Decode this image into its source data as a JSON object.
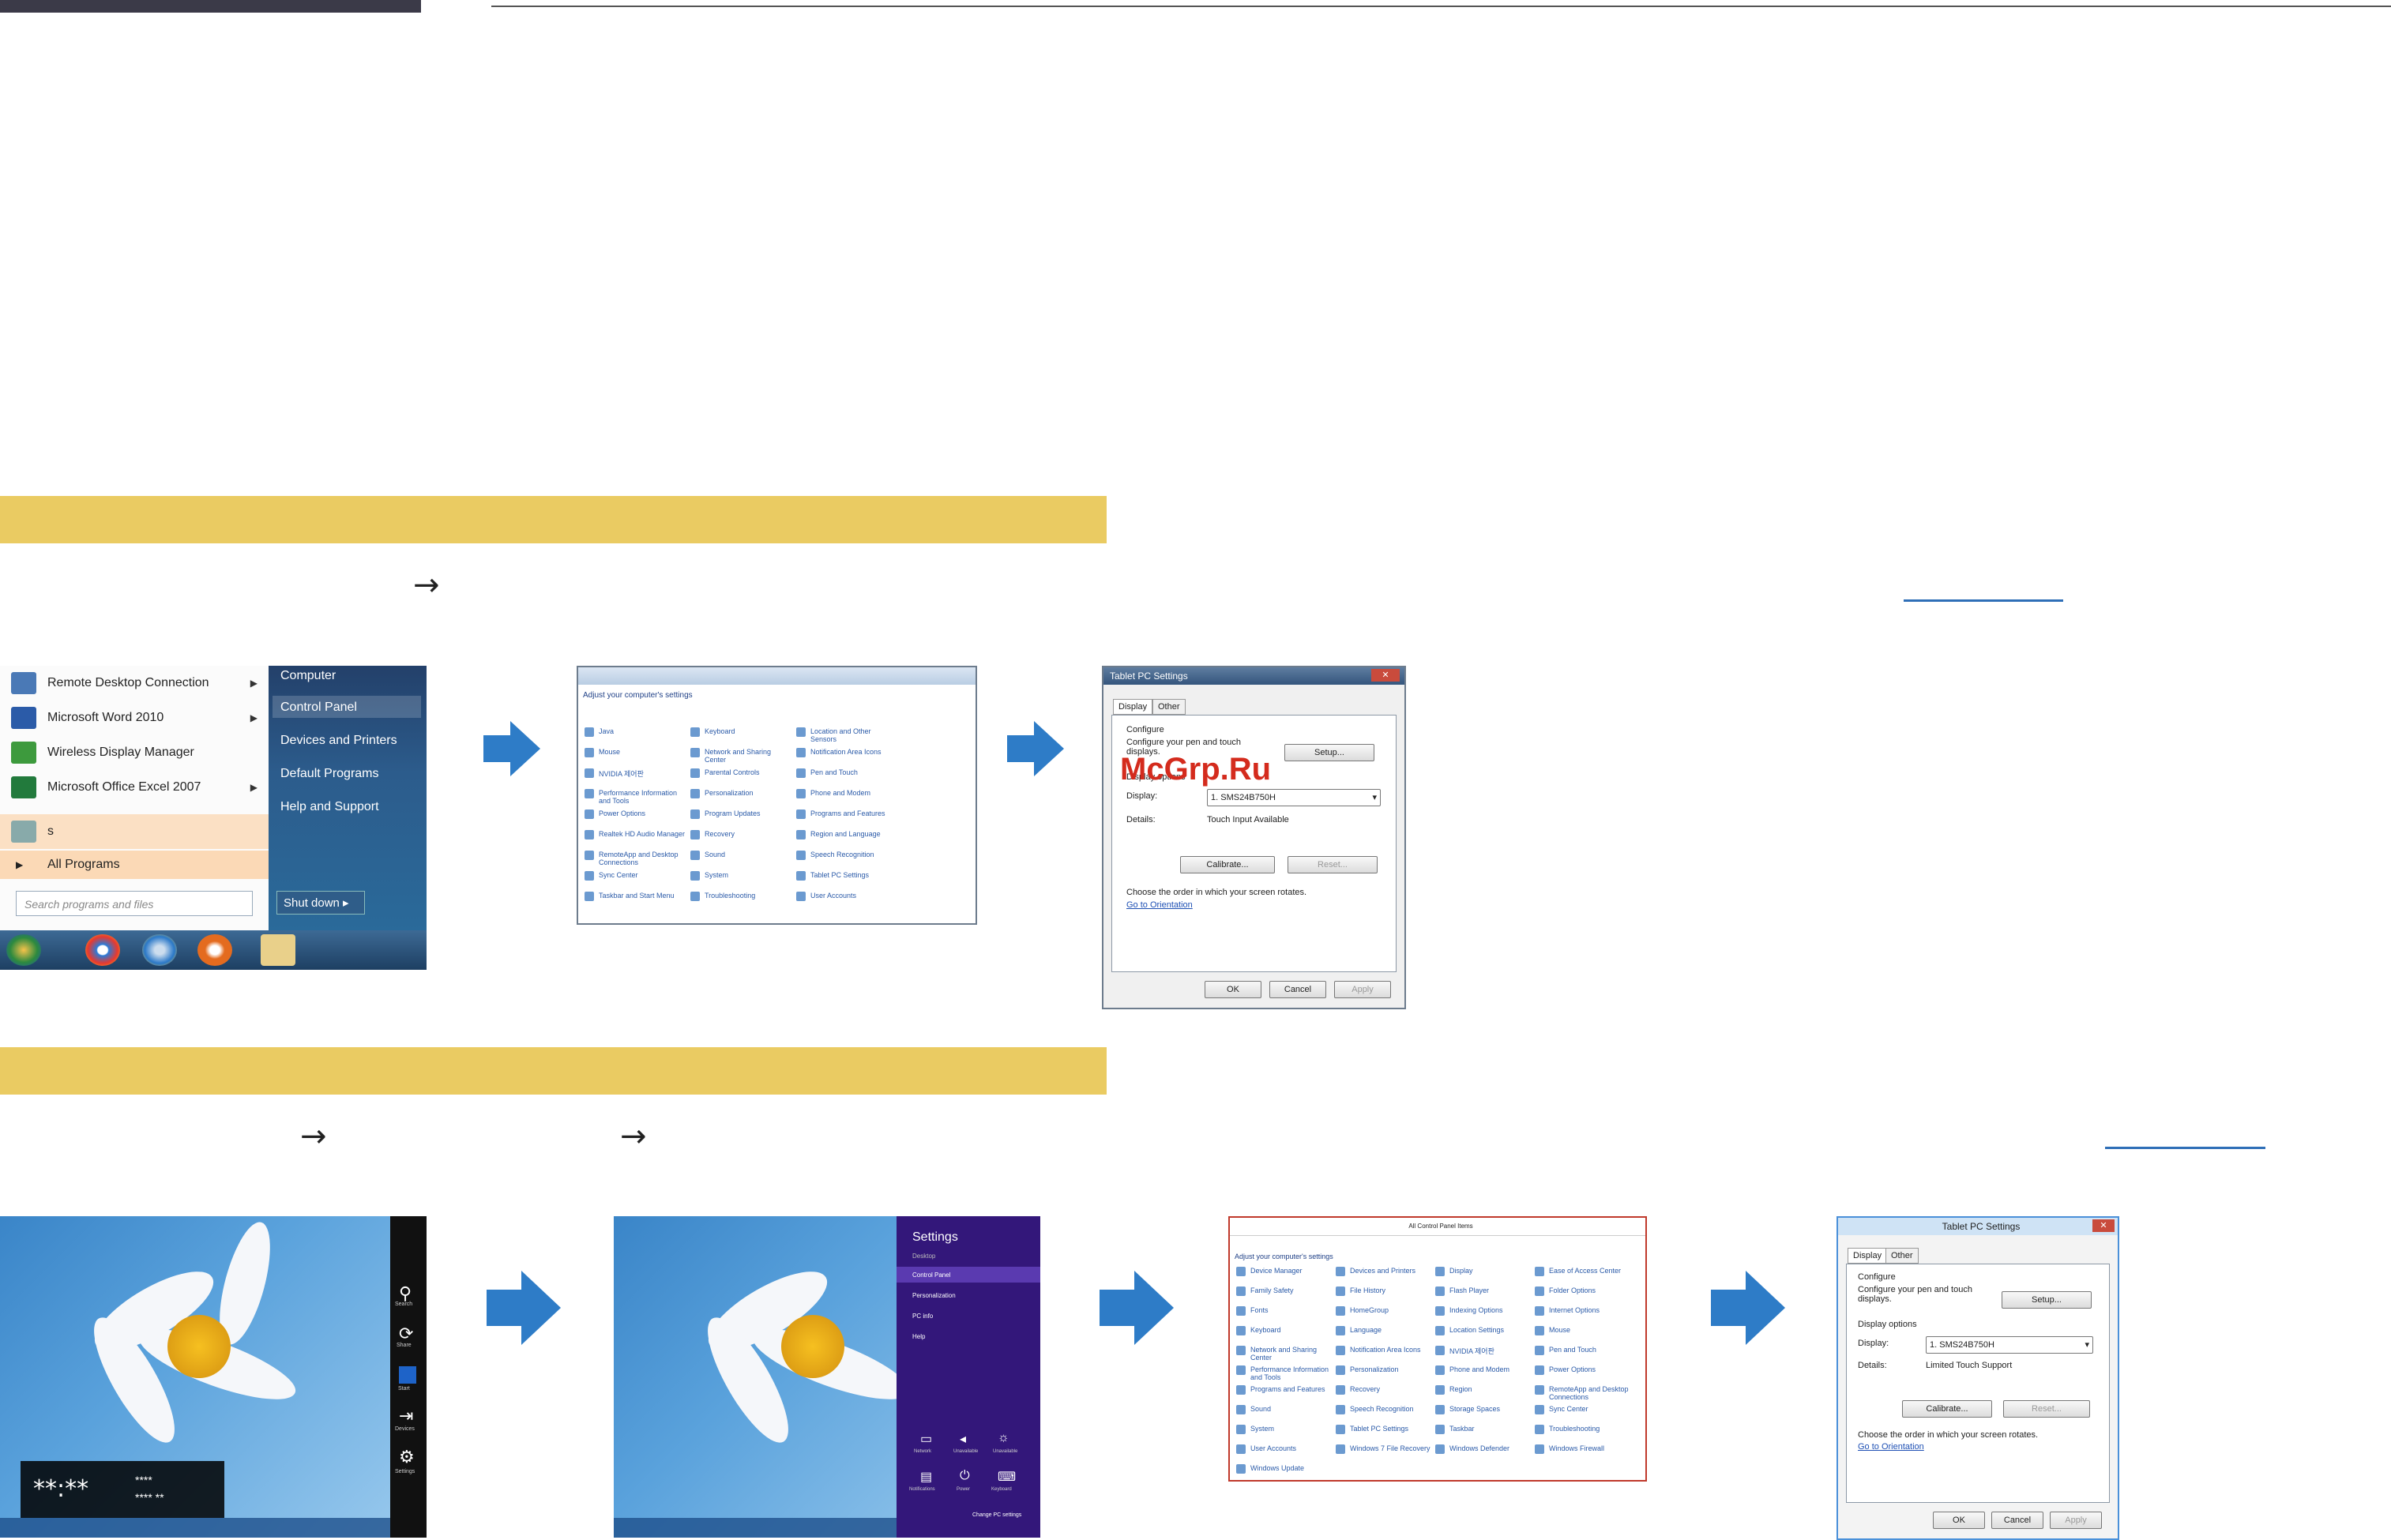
{
  "watermark": "McGrp.Ru",
  "section1": {
    "arrow": "→",
    "start_menu": {
      "programs": [
        {
          "label": "Remote Desktop Connection",
          "has_submenu": true
        },
        {
          "label": "Microsoft Word 2010",
          "has_submenu": true
        },
        {
          "label": "Wireless Display Manager",
          "has_submenu": false
        },
        {
          "label": "Microsoft Office Excel 2007",
          "has_submenu": true
        },
        {
          "label": "s",
          "has_submenu": false
        }
      ],
      "all_programs": "All Programs",
      "search_placeholder": "Search programs and files",
      "right_items": [
        "Computer",
        "Control Panel",
        "Devices and Printers",
        "Default Programs",
        "Help and Support"
      ],
      "shutdown": "Shut down"
    },
    "control_panel": {
      "heading": "Adjust your computer's settings",
      "items": [
        "Java",
        "Keyboard",
        "Location and Other Sensors",
        "Mouse",
        "Network and Sharing Center",
        "Notification Area Icons",
        "NVIDIA 제어판",
        "Parental Controls",
        "Pen and Touch",
        "Performance Information and Tools",
        "Personalization",
        "Phone and Modem",
        "Power Options",
        "Program Updates",
        "Programs and Features",
        "Realtek HD Audio Manager",
        "Recovery",
        "Region and Language",
        "RemoteApp and Desktop Connections",
        "Sound",
        "Speech Recognition",
        "Sync Center",
        "System",
        "Tablet PC Settings",
        "Taskbar and Start Menu",
        "Troubleshooting",
        "User Accounts"
      ]
    },
    "tablet_settings": {
      "title": "Tablet PC Settings",
      "tabs": [
        "Display",
        "Other"
      ],
      "configure": "Configure",
      "configure_desc": "Configure your pen and touch displays.",
      "setup": "Setup...",
      "display_options": "Display options",
      "display_label": "Display:",
      "display_value": "1. SMS24B750H",
      "details_label": "Details:",
      "details_value": "Touch Input Available",
      "calibrate": "Calibrate...",
      "reset": "Reset...",
      "orientation_text": "Choose the order in which your screen rotates.",
      "orientation_link": "Go to Orientation",
      "ok": "OK",
      "cancel": "Cancel",
      "apply": "Apply"
    }
  },
  "section2": {
    "arrow1": "→",
    "arrow2": "→",
    "charms": [
      "Search",
      "Share",
      "Start",
      "Devices",
      "Settings"
    ],
    "clock_text": "**:**",
    "clock_sub1": "****",
    "clock_sub2": "**** **",
    "settings_pane": {
      "title": "Settings",
      "subtitle": "Desktop",
      "items": [
        "Control Panel",
        "Personalization",
        "PC info",
        "Help"
      ],
      "icons": [
        "Network",
        "Unavailable",
        "Unavailable",
        "Notifications",
        "Power",
        "Keyboard"
      ],
      "change": "Change PC settings"
    },
    "control_panel8": {
      "title": "All Control Panel Items",
      "heading": "Adjust your computer's settings",
      "items": [
        "Device Manager",
        "Devices and Printers",
        "Display",
        "Ease of Access Center",
        "Family Safety",
        "File History",
        "Flash Player",
        "Folder Options",
        "Fonts",
        "HomeGroup",
        "Indexing Options",
        "Internet Options",
        "Keyboard",
        "Language",
        "Location Settings",
        "Mouse",
        "Network and Sharing Center",
        "Notification Area Icons",
        "NVIDIA 제어판",
        "Pen and Touch",
        "Performance Information and Tools",
        "Personalization",
        "Phone and Modem",
        "Power Options",
        "Programs and Features",
        "Recovery",
        "Region",
        "RemoteApp and Desktop Connections",
        "Sound",
        "Speech Recognition",
        "Storage Spaces",
        "Sync Center",
        "System",
        "Tablet PC Settings",
        "Taskbar",
        "Troubleshooting",
        "User Accounts",
        "Windows 7 File Recovery",
        "Windows Defender",
        "Windows Firewall",
        "Windows Update"
      ]
    },
    "tablet_settings8": {
      "title": "Tablet PC Settings",
      "tabs": [
        "Display",
        "Other"
      ],
      "configure": "Configure",
      "configure_desc": "Configure your pen and touch displays.",
      "setup": "Setup...",
      "display_options": "Display options",
      "display_label": "Display:",
      "display_value": "1. SMS24B750H",
      "details_label": "Details:",
      "details_value": "Limited Touch Support",
      "calibrate": "Calibrate...",
      "reset": "Reset...",
      "orientation_text": "Choose the order in which your screen rotates.",
      "orientation_link": "Go to Orientation",
      "ok": "OK",
      "cancel": "Cancel",
      "apply": "Apply"
    }
  }
}
